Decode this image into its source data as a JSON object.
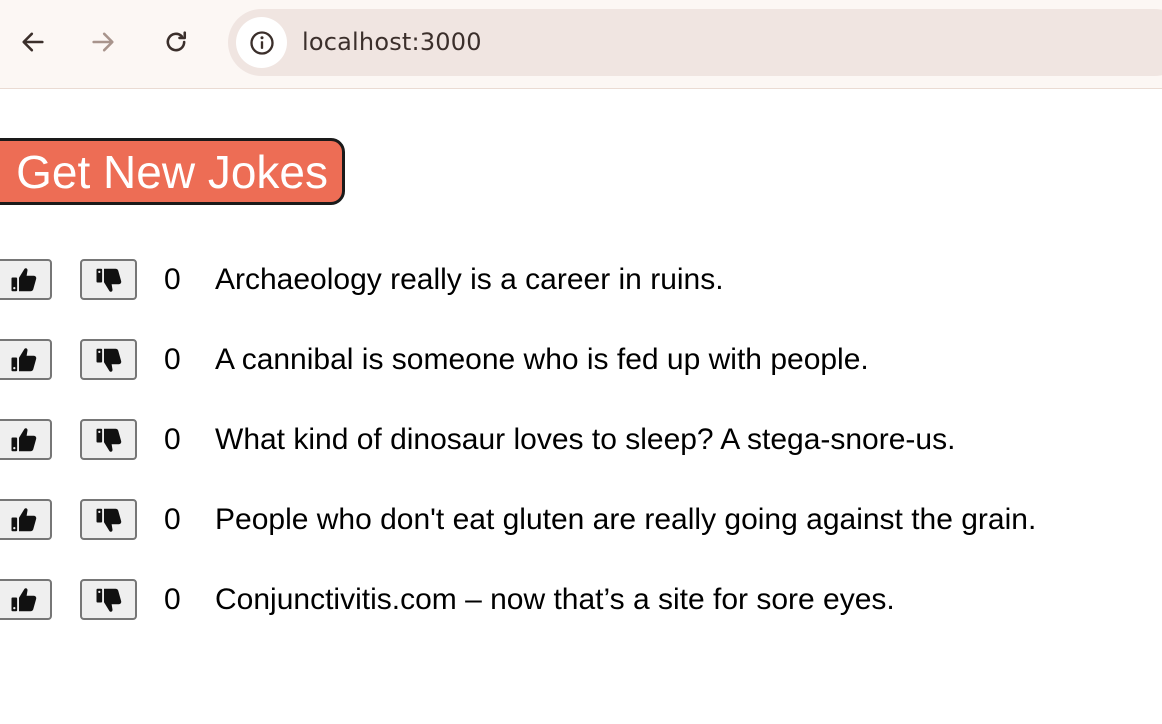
{
  "browser": {
    "url": "localhost:3000",
    "icons": {
      "back": "arrow-left-icon",
      "forward": "arrow-right-icon",
      "reload": "reload-icon",
      "site_info": "info-icon"
    }
  },
  "page": {
    "get_jokes_label": "Get New Jokes",
    "button_color": "#ed6d55",
    "jokes": [
      {
        "score": "0",
        "text": "Archaeology really is a career in ruins."
      },
      {
        "score": "0",
        "text": "A cannibal is someone who is fed up with people."
      },
      {
        "score": "0",
        "text": "What kind of dinosaur loves to sleep? A stega-snore-us."
      },
      {
        "score": "0",
        "text": "People who don't eat gluten are really going against the grain."
      },
      {
        "score": "0",
        "text": "Conjunctivitis.com – now that’s a site for sore eyes."
      }
    ],
    "vote_icons": {
      "up": "thumbs-up-icon",
      "down": "thumbs-down-icon"
    }
  }
}
